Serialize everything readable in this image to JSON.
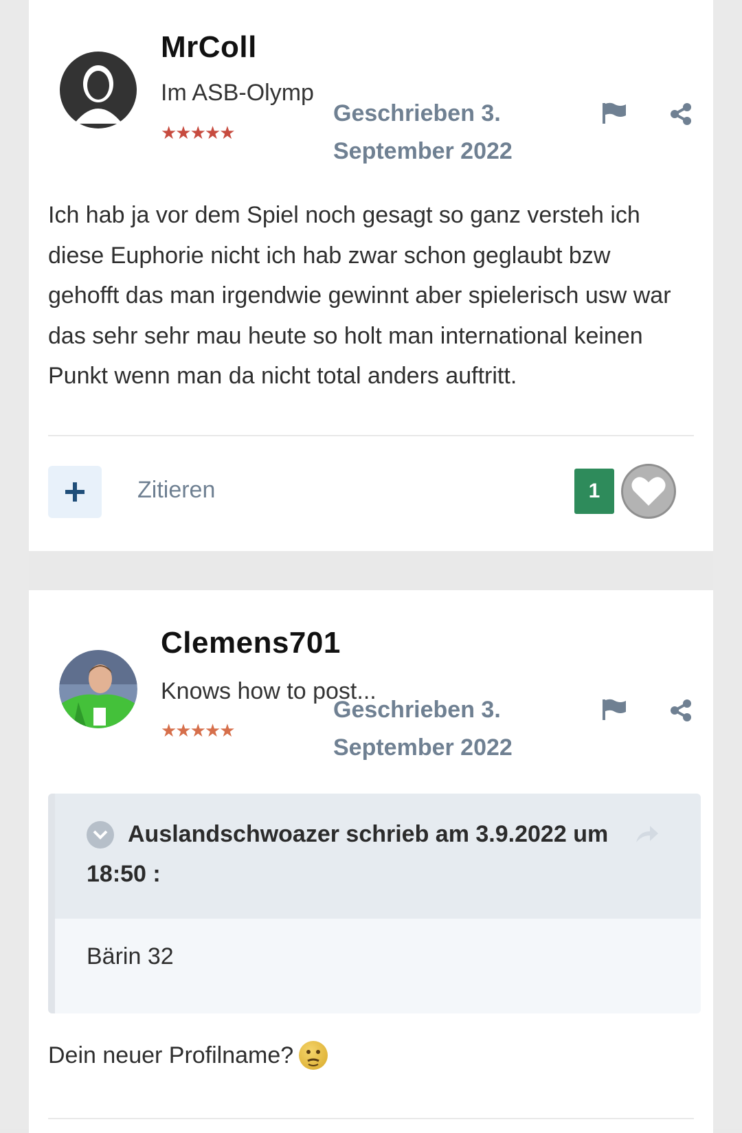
{
  "posts": [
    {
      "author": "MrColl",
      "rank": "Im ASB-Olymp",
      "stars": "★★★★★",
      "date": "Geschrieben 3. September 2022",
      "body": "Ich hab ja vor dem Spiel noch gesagt so ganz versteh ich diese Euphorie nicht ich hab zwar schon geglaubt bzw gehofft das man irgendwie gewinnt aber spielerisch usw war das sehr sehr mau heute so holt man international keinen Punkt wenn man da nicht total anders auftritt.",
      "actions": {
        "multiquote_symbol": "+",
        "quote_label": "Zitieren",
        "reaction_count": "1"
      }
    },
    {
      "author": "Clemens701",
      "rank": "Knows how to post...",
      "stars": "★★★★★",
      "date": "Geschrieben 3. September 2022",
      "quote": {
        "citation": "Auslandschwoazer schrieb am 3.9.2022 um 18:50 :",
        "content": "Bärin 32"
      },
      "body": "Dein neuer Profilname?"
    }
  ],
  "colors": {
    "reaction_badge": "#2e8b5b",
    "meta_text": "#6f8092",
    "stars_post1": "#c74b3f",
    "stars_post2": "#d66f4b"
  },
  "icons": {
    "flag": "flag-icon",
    "share": "share-icon",
    "heart": "heart-icon",
    "quote_toggle": "chevron-down-icon",
    "quote_goto": "share-arrow-icon",
    "emoji": "thinking-face-icon"
  }
}
